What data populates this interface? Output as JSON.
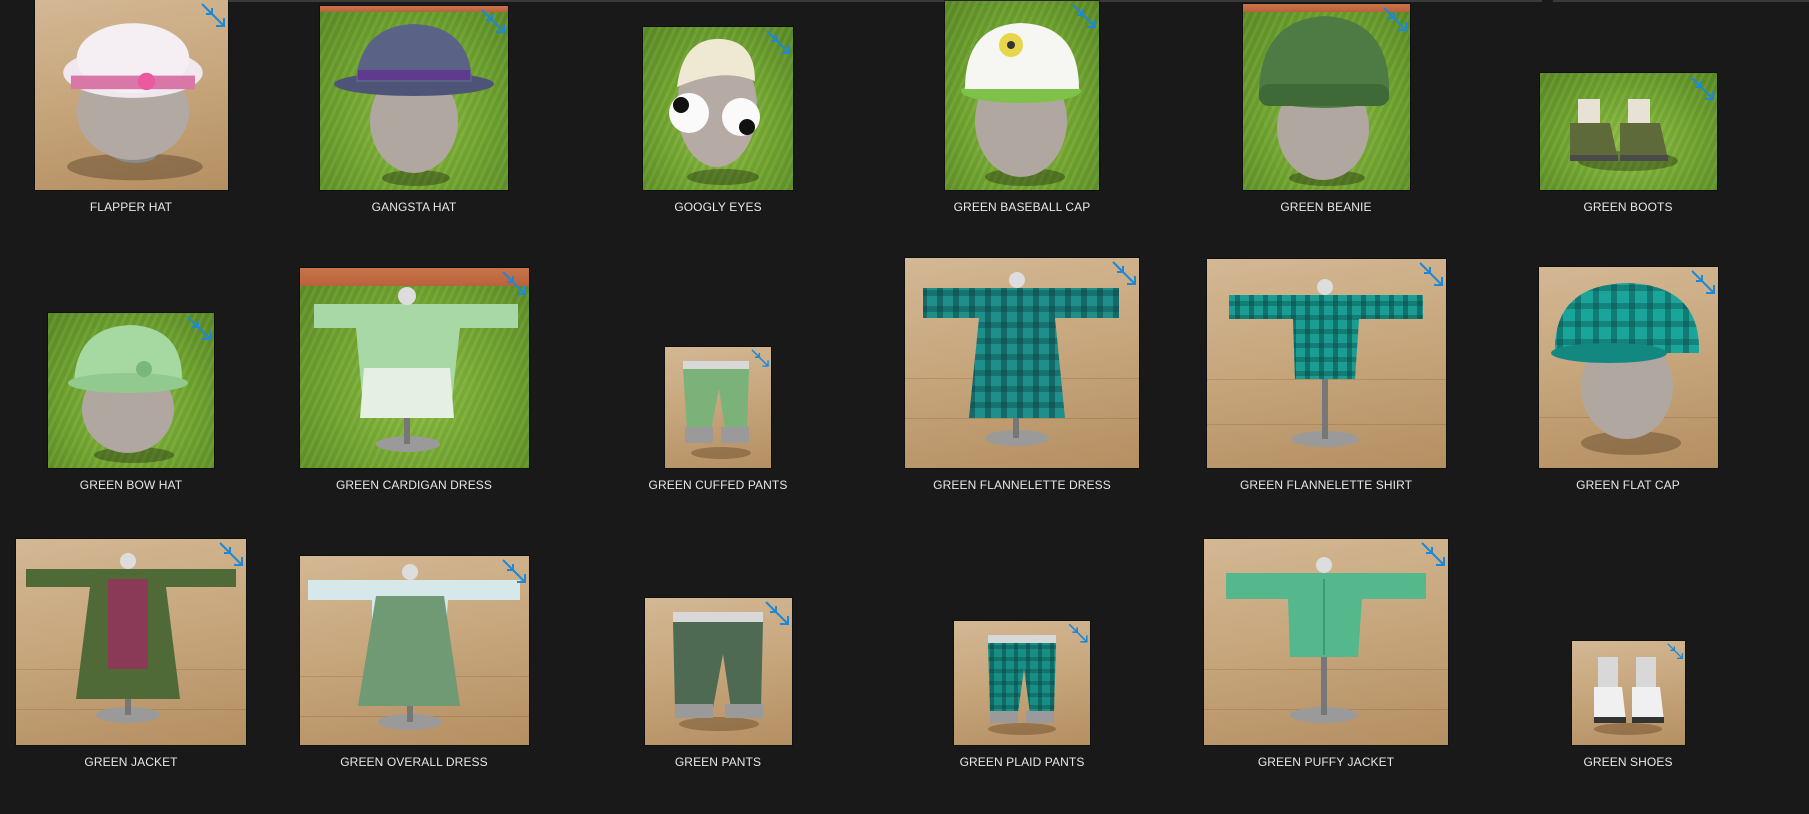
{
  "items": [
    {
      "label": "FLAPPER HAT",
      "bg": "wood"
    },
    {
      "label": "GANGSTA HAT",
      "bg": "grass"
    },
    {
      "label": "GOOGLY EYES",
      "bg": "grass"
    },
    {
      "label": "GREEN BASEBALL CAP",
      "bg": "grass"
    },
    {
      "label": "GREEN BEANIE",
      "bg": "grass"
    },
    {
      "label": "GREEN BOOTS",
      "bg": "grass"
    },
    {
      "label": "GREEN BOW HAT",
      "bg": "grass"
    },
    {
      "label": "GREEN CARDIGAN DRESS",
      "bg": "grass"
    },
    {
      "label": "GREEN CUFFED PANTS",
      "bg": "wood"
    },
    {
      "label": "GREEN FLANNELETTE DRESS",
      "bg": "wood"
    },
    {
      "label": "GREEN FLANNELETTE SHIRT",
      "bg": "wood"
    },
    {
      "label": "GREEN FLAT CAP",
      "bg": "wood"
    },
    {
      "label": "GREEN JACKET",
      "bg": "wood"
    },
    {
      "label": "GREEN OVERALL DRESS",
      "bg": "wood"
    },
    {
      "label": "GREEN PANTS",
      "bg": "wood"
    },
    {
      "label": "GREEN PLAID PANTS",
      "bg": "wood"
    },
    {
      "label": "GREEN PUFFY JACKET",
      "bg": "wood"
    },
    {
      "label": "GREEN SHOES",
      "bg": "wood"
    }
  ],
  "icons": {
    "expand": "expand-arrows-icon"
  },
  "colors": {
    "background": "#191919",
    "caption": "#e8e8e8",
    "accent": "#1e88d8"
  }
}
